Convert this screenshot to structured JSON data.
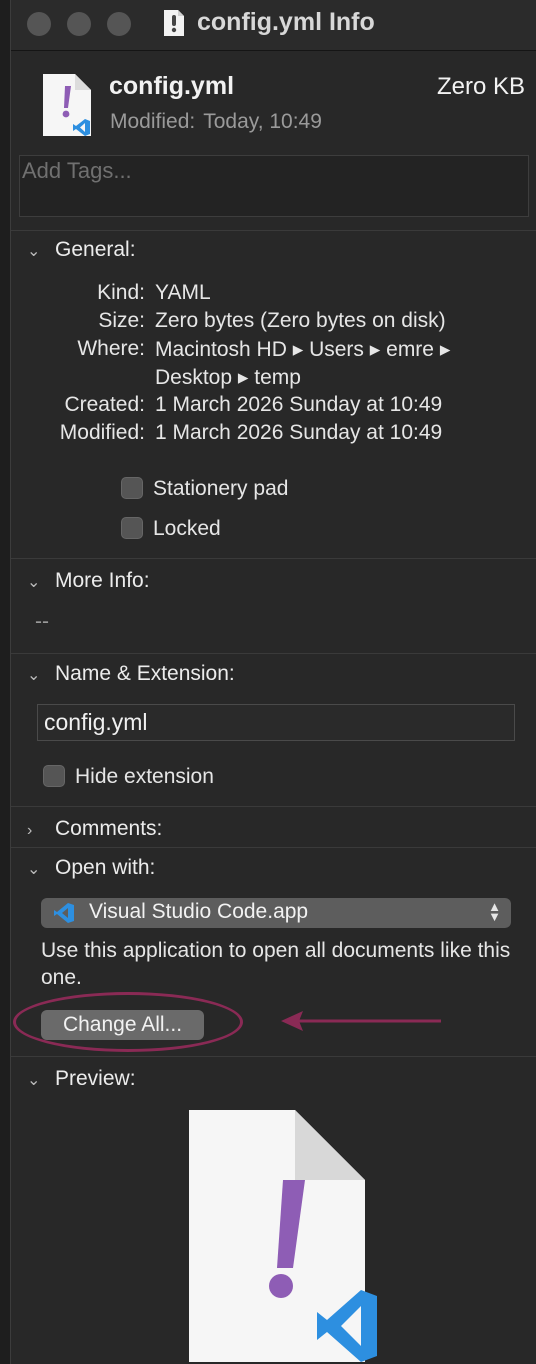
{
  "window": {
    "title": "config.yml Info"
  },
  "header": {
    "file_name": "config.yml",
    "size": "Zero KB",
    "modified_label": "Modified:",
    "modified_value": "Today, 10:49"
  },
  "tags": {
    "placeholder": "Add Tags..."
  },
  "general": {
    "heading": "General:",
    "rows": [
      {
        "key": "Kind:",
        "value": "YAML"
      },
      {
        "key": "Size:",
        "value": "Zero bytes (Zero bytes on disk)"
      },
      {
        "key": "Where:",
        "value": "Macintosh HD ▸ Users ▸ emre ▸",
        "value2": "Desktop ▸ temp"
      },
      {
        "key": "Created:",
        "value": "1 March 2026 Sunday at 10:49"
      },
      {
        "key": "Modified:",
        "value": "1 March 2026 Sunday at 10:49"
      }
    ],
    "stationery_label": "Stationery pad",
    "locked_label": "Locked"
  },
  "more_info": {
    "heading": "More Info:",
    "value": "--"
  },
  "name_ext": {
    "heading": "Name & Extension:",
    "value": "config.yml",
    "hide_ext_label": "Hide extension"
  },
  "comments": {
    "heading": "Comments:"
  },
  "open_with": {
    "heading": "Open with:",
    "app": "Visual Studio Code.app",
    "description": "Use this application to open all documents like this one.",
    "change_all": "Change All..."
  },
  "preview": {
    "heading": "Preview:"
  },
  "colors": {
    "background": "#282828",
    "annotation": "#8a2a55",
    "vscode_blue": "#2d8fe0",
    "yaml_purple": "#8e5db5"
  }
}
